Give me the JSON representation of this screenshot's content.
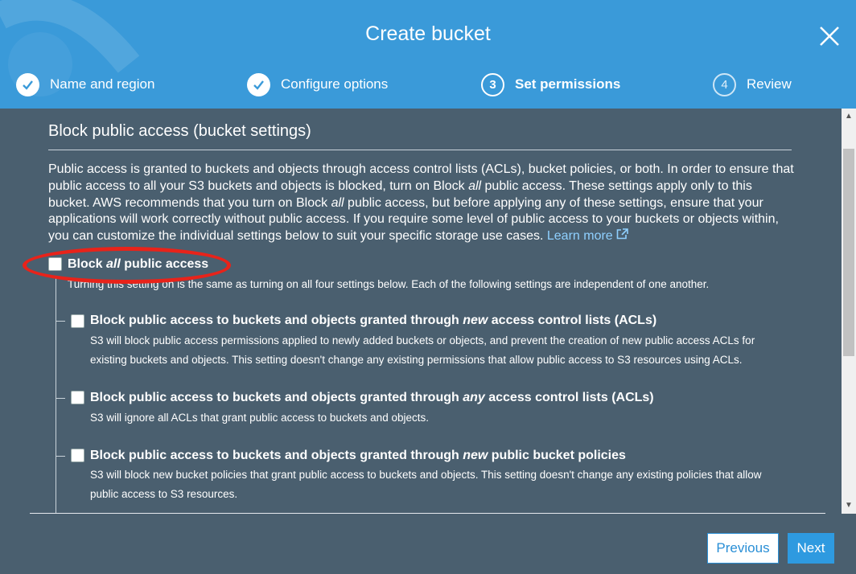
{
  "dialog": {
    "title": "Create bucket"
  },
  "steps": [
    {
      "num": "",
      "label": "Name and region",
      "state": "done"
    },
    {
      "num": "",
      "label": "Configure options",
      "state": "done"
    },
    {
      "num": "3",
      "label": "Set permissions",
      "state": "current"
    },
    {
      "num": "4",
      "label": "Review",
      "state": "todo"
    }
  ],
  "section": {
    "title": "Block public access (bucket settings)",
    "intro_part1": "Public access is granted to buckets and objects through access control lists (ACLs), bucket policies, or both. In order to ensure that public access to all your S3 buckets and objects is blocked, turn on Block ",
    "intro_em1": "all",
    "intro_part2": " public access. These settings apply only to this bucket. AWS recommends that you turn on Block ",
    "intro_em2": "all",
    "intro_part3": " public access, but before applying any of these settings, ensure that your applications will work correctly without public access. If you require some level of public access to your buckets or objects within, you can customize the individual settings below to suit your specific storage use cases. ",
    "learn_more": "Learn more"
  },
  "block_all": {
    "label_pre": "Block ",
    "label_em": "all",
    "label_post": " public access",
    "checked": false,
    "desc": "Turning this setting on is the same as turning on all four settings below. Each of the following settings are independent of one another."
  },
  "options": [
    {
      "title_pre": "Block public access to buckets and objects granted through ",
      "title_em": "new",
      "title_post": " access control lists (ACLs)",
      "checked": false,
      "desc": "S3 will block public access permissions applied to newly added buckets or objects, and prevent the creation of new public access ACLs for existing buckets and objects. This setting doesn't change any existing permissions that allow public access to S3 resources using ACLs."
    },
    {
      "title_pre": "Block public access to buckets and objects granted through ",
      "title_em": "any",
      "title_post": " access control lists (ACLs)",
      "checked": false,
      "desc": "S3 will ignore all ACLs that grant public access to buckets and objects."
    },
    {
      "title_pre": "Block public access to buckets and objects granted through ",
      "title_em": "new",
      "title_post": " public bucket policies",
      "checked": false,
      "desc": "S3 will block new bucket policies that grant public access to buckets and objects. This setting doesn't change any existing policies that allow public access to S3 resources."
    }
  ],
  "footer": {
    "previous": "Previous",
    "next": "Next"
  },
  "colors": {
    "header": "#3a9ad9",
    "body": "#4a5f6f",
    "highlight": "#e8231a",
    "link": "#8fd0ff"
  },
  "icons": {
    "close": "close-icon",
    "step_done": "check-circle-icon",
    "external": "external-link-icon"
  }
}
